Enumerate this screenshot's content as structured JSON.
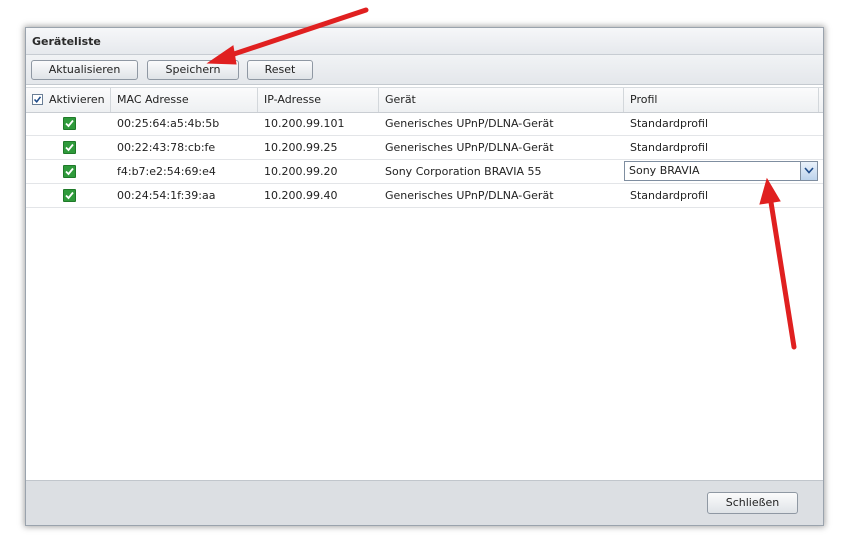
{
  "dialog": {
    "title": "Geräteliste"
  },
  "toolbar": {
    "refresh_label": "Aktualisieren",
    "save_label": "Speichern",
    "reset_label": "Reset"
  },
  "grid": {
    "columns": [
      "Aktivieren",
      "MAC Adresse",
      "IP-Adresse",
      "Gerät",
      "Profil"
    ],
    "rows": [
      {
        "enabled": true,
        "mac": "00:25:64:a5:4b:5b",
        "ip": "10.200.99.101",
        "device": "Generisches UPnP/DLNA-Gerät",
        "profile": "Standardprofil"
      },
      {
        "enabled": true,
        "mac": "00:22:43:78:cb:fe",
        "ip": "10.200.99.25",
        "device": "Generisches UPnP/DLNA-Gerät",
        "profile": "Standardprofil"
      },
      {
        "enabled": true,
        "mac": "f4:b7:e2:54:69:e4",
        "ip": "10.200.99.20",
        "device": "Sony Corporation BRAVIA 55",
        "profile": "Sony BRAVIA"
      },
      {
        "enabled": true,
        "mac": "00:24:54:1f:39:aa",
        "ip": "10.200.99.40",
        "device": "Generisches UPnP/DLNA-Gerät",
        "profile": "Standardprofil"
      }
    ]
  },
  "footer": {
    "close_label": "Schließen"
  },
  "colors": {
    "annotation_arrow": "#e02020",
    "check_green": "#2f9a3b"
  },
  "icons": {
    "header_checkbox": "checkbox-checked-icon",
    "row_checkbox": "green-check-icon",
    "combo_arrow": "chevron-down-icon"
  }
}
